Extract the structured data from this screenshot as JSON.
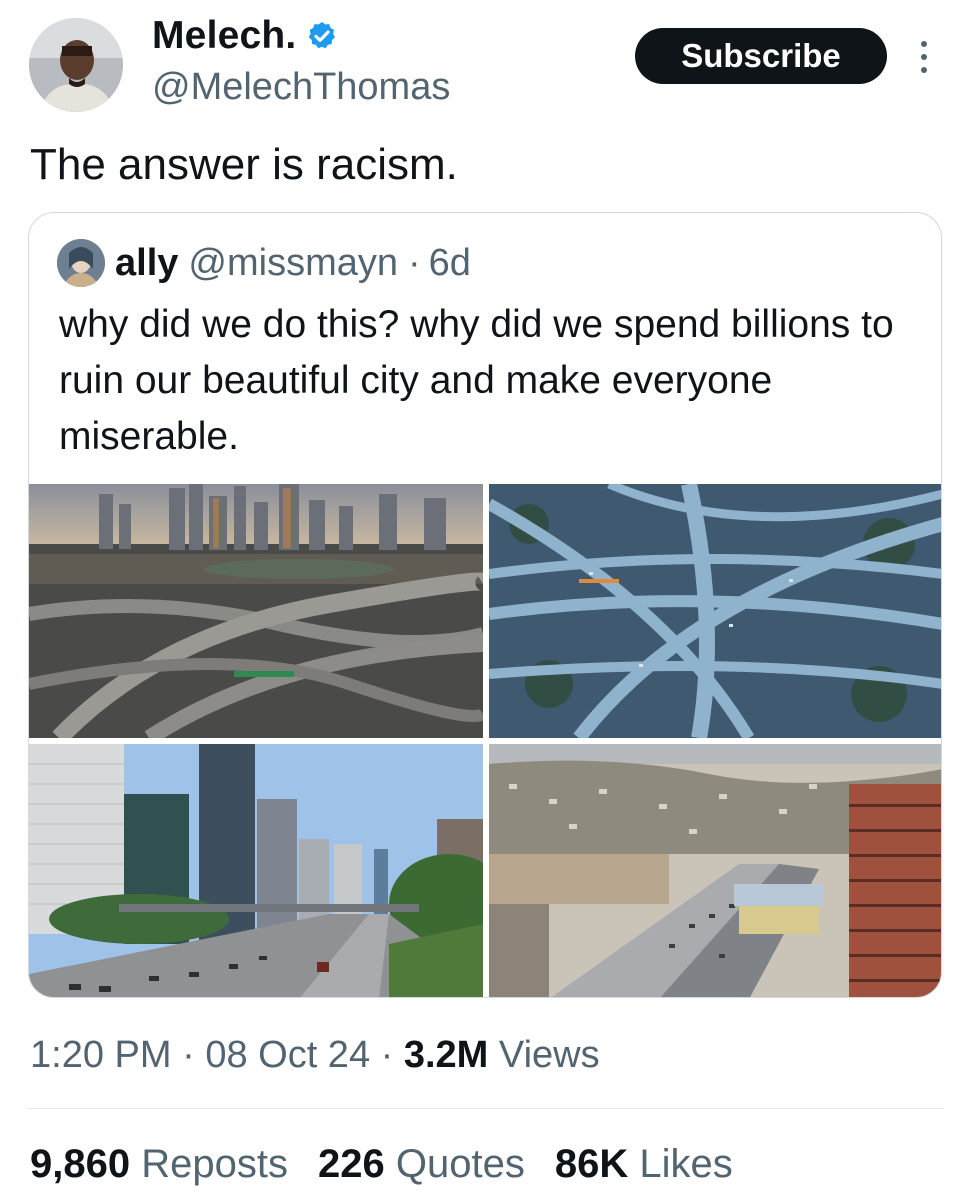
{
  "author": {
    "display_name": "Melech.",
    "handle": "@MelechThomas",
    "verified": true,
    "icons": [
      "avatar",
      "verified-badge-icon",
      "more-options-icon"
    ]
  },
  "subscribe_label": "Subscribe",
  "tweet_text": "The answer is racism.",
  "quoted": {
    "display_name": "ally",
    "handle": "@missmayn",
    "separator": "·",
    "age": "6d",
    "text": "why did we do this? why did we spend billions to ruin our beautiful city and make everyone miserable.",
    "photos": [
      "downtown-freeway-interchange",
      "aerial-stack-interchange",
      "freeway-through-downtown",
      "freeway-hillside-view"
    ]
  },
  "meta": {
    "time": "1:20 PM",
    "date": "08 Oct 24",
    "views_count": "3.2M",
    "views_label": "Views",
    "separator": "·"
  },
  "stats": {
    "reposts_count": "9,860",
    "reposts_label": "Reposts",
    "quotes_count": "226",
    "quotes_label": "Quotes",
    "likes_count": "86K",
    "likes_label": "Likes"
  },
  "colors": {
    "text": "#0f1419",
    "secondary": "#536471",
    "verified": "#1d9bf0",
    "button": "#0f1419",
    "border": "#cfd9de"
  }
}
